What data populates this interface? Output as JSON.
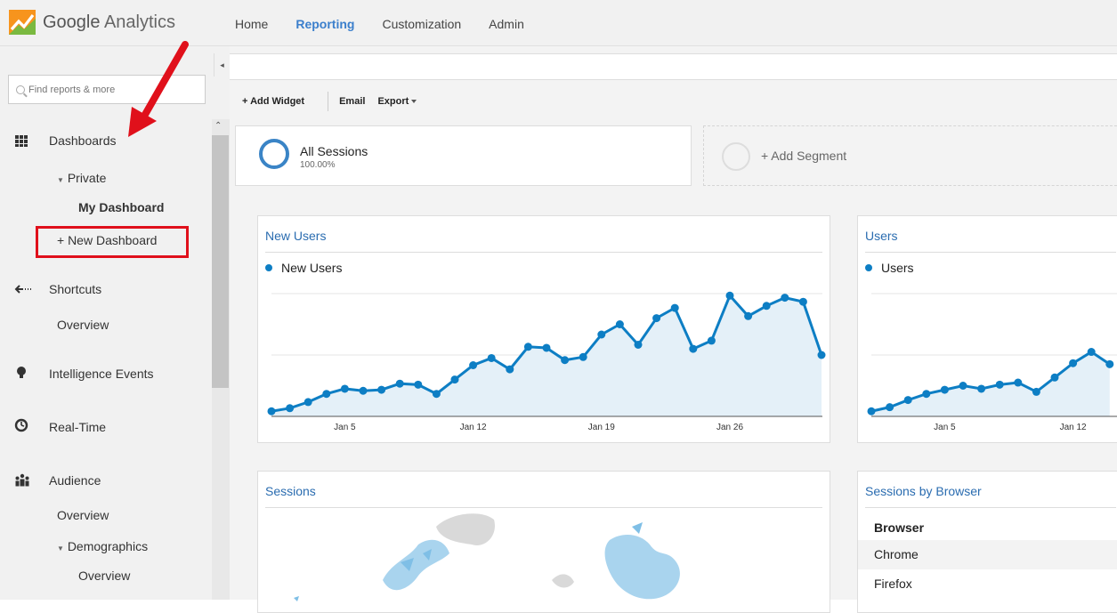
{
  "app": {
    "logo_google": "Google",
    "logo_product": "Analytics"
  },
  "nav": {
    "tabs": [
      {
        "label": "Home"
      },
      {
        "label": "Reporting"
      },
      {
        "label": "Customization"
      },
      {
        "label": "Admin"
      }
    ]
  },
  "sidebar": {
    "search_placeholder": "Find reports & more",
    "dashboards": "Dashboards",
    "private": "Private",
    "my_dashboard": "My Dashboard",
    "new_dashboard": "+ New Dashboard",
    "shortcuts": "Shortcuts",
    "shortcuts_overview": "Overview",
    "intelligence": "Intelligence Events",
    "realtime": "Real-Time",
    "audience": "Audience",
    "audience_overview": "Overview",
    "demographics": "Demographics",
    "demographics_overview": "Overview"
  },
  "toolbar": {
    "add_widget": "+ Add Widget",
    "email": "Email",
    "export": "Export"
  },
  "segments": {
    "all_sessions": "All Sessions",
    "all_sessions_pct": "100.00%",
    "add_segment": "+ Add Segment"
  },
  "widgets": {
    "new_users": {
      "title": "New Users",
      "legend": "New Users"
    },
    "users": {
      "title": "Users",
      "legend": "Users"
    },
    "sessions": {
      "title": "Sessions"
    },
    "browser": {
      "title": "Sessions by Browser",
      "column": "Browser",
      "rows": [
        "Chrome",
        "Firefox"
      ]
    }
  },
  "colors": {
    "accent": "#0d7ec4",
    "fill": "#e4f0f8",
    "highlight": "#e0101b"
  },
  "chart_data": [
    {
      "type": "area",
      "title": "New Users",
      "series": [
        {
          "name": "New Users",
          "values": [
            0.5,
            0.8,
            1.4,
            2.2,
            2.7,
            2.5,
            2.6,
            3.2,
            3.1,
            2.2,
            3.6,
            5.0,
            5.7,
            4.6,
            6.8,
            6.7,
            5.5,
            5.8,
            8.0,
            9.0,
            7.0,
            9.6,
            10.6,
            6.6,
            7.4,
            11.8,
            9.8,
            10.8,
            11.6,
            11.2,
            6.0
          ]
        }
      ],
      "x_tick_labels": [
        "Jan 5",
        "Jan 12",
        "Jan 19",
        "Jan 26"
      ],
      "grid": true
    },
    {
      "type": "area",
      "title": "Users",
      "series": [
        {
          "name": "Users",
          "values": [
            0.5,
            0.9,
            1.6,
            2.2,
            2.6,
            3.0,
            2.7,
            3.1,
            3.3,
            2.4,
            3.8,
            5.2,
            6.3,
            5.1
          ]
        }
      ],
      "x_tick_labels": [
        "Jan 5",
        "Jan 12"
      ],
      "grid": true
    }
  ]
}
